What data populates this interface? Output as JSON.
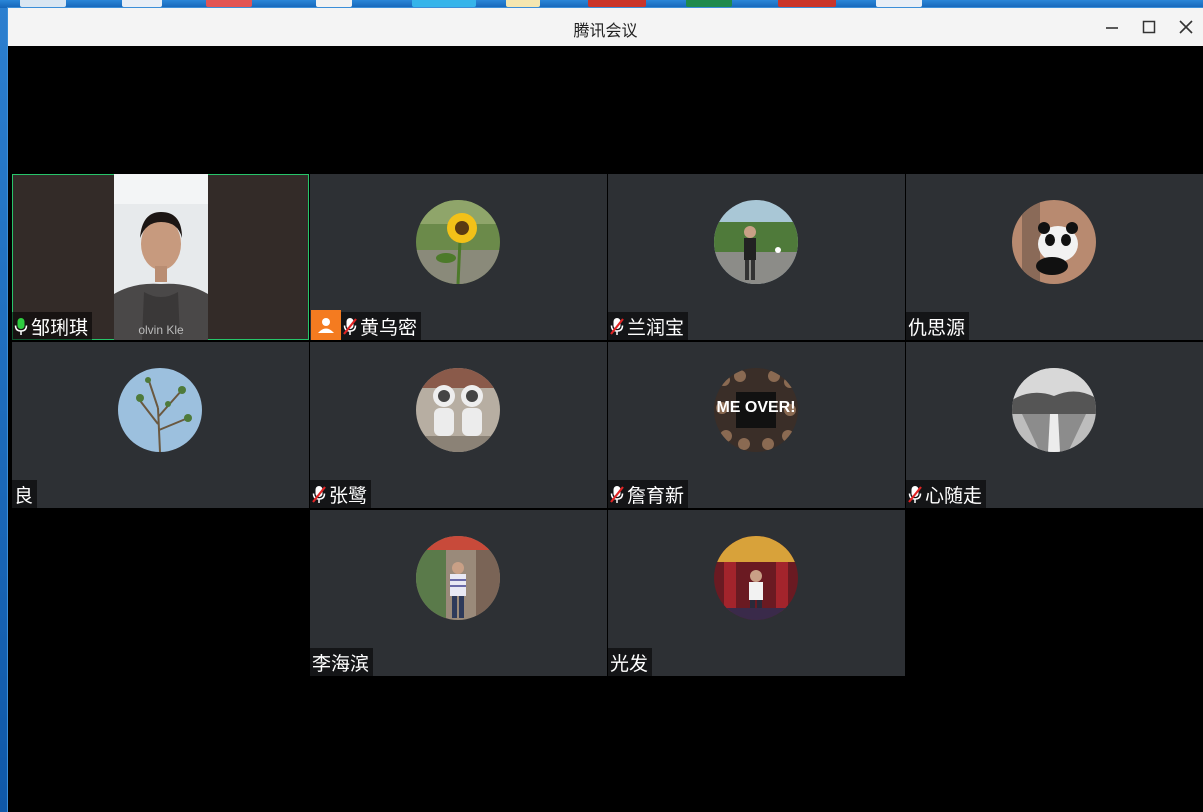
{
  "window": {
    "title": "腾讯会议"
  },
  "participants": [
    {
      "name": "邹琍琪",
      "mic": "on",
      "video": true
    },
    {
      "name": "黄乌密",
      "mic": "muted",
      "host": true,
      "avatar": "sunflower"
    },
    {
      "name": "兰润宝",
      "mic": "muted",
      "avatar": "man-outdoors"
    },
    {
      "name": "仇思源",
      "mic": "none",
      "avatar": "panda"
    },
    {
      "name": "良",
      "mic": "none",
      "avatar": "tree-branches"
    },
    {
      "name": "张鹭",
      "mic": "muted",
      "avatar": "astronaut-figures"
    },
    {
      "name": "詹育新",
      "mic": "muted",
      "avatar": "me-over-collage"
    },
    {
      "name": "心随走",
      "mic": "muted",
      "avatar": "landscape"
    },
    {
      "name": "李海滨",
      "mic": "none",
      "avatar": "man-standing"
    },
    {
      "name": "光发",
      "mic": "none",
      "avatar": "man-in-temple"
    }
  ],
  "icons": {
    "mic_on": "microphone-icon",
    "mic_muted": "microphone-muted-icon",
    "host": "host-icon",
    "minimize": "minimize-icon",
    "maximize": "maximize-icon",
    "close": "close-icon"
  },
  "colors": {
    "active_border": "#27c46a",
    "host_badge": "#f47b20",
    "mic_on": "#2ecc40",
    "mic_muted": "#e02424",
    "tile_bg": "#2d3034",
    "title_bar": "#f4f4f4"
  },
  "avatar_images": {
    "me_over_text": "ME OVER!"
  }
}
